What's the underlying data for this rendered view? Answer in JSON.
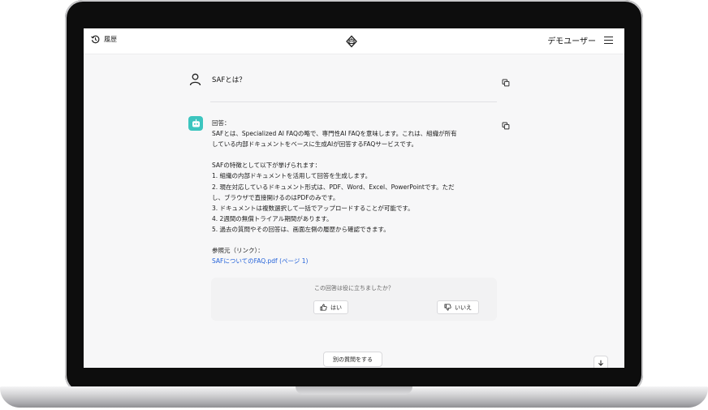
{
  "header": {
    "history_label": "履歴",
    "user_name": "デモユーザー"
  },
  "conversation": {
    "question": "SAFとは？",
    "answer": {
      "lines": [
        "回答：",
        "SAFとは、Specialized AI FAQの略で、専門性AI FAQを意味します。これは、組織が所有",
        "している内部ドキュメントをベースに生成AIが回答するFAQサービスです。",
        "",
        "SAFの特徴として以下が挙げられます：",
        "1. 組織の内部ドキュメントを活用して回答を生成します。",
        "2. 現在対応しているドキュメント形式は、PDF、Word、Excel、PowerPointです。ただ",
        "し、ブラウザで直接開けるのはPDFのみです。",
        "3. ドキュメントは複数選択して一括でアップロードすることが可能です。",
        "4. 2週間の無償トライアル期間があります。",
        "5. 過去の質問やその回答は、画面左側の履歴から確認できます。",
        "",
        "参照元（リンク）："
      ],
      "reference_link": "SAFについてのFAQ.pdf (ページ 1)"
    }
  },
  "feedback": {
    "question": "この回答は役に立ちましたか？",
    "yes_label": "はい",
    "no_label": "いいえ"
  },
  "actions": {
    "another_question_label": "別の質問をする"
  },
  "colors": {
    "bot_avatar": "#3cc5bf",
    "link": "#2563d9"
  }
}
